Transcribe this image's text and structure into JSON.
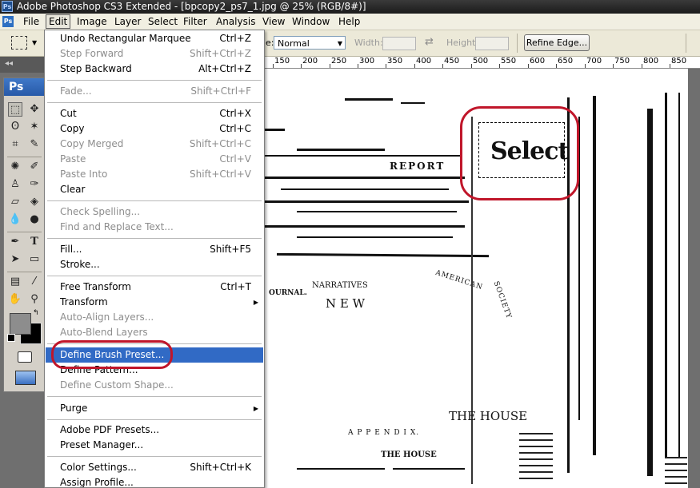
{
  "window": {
    "title": "Adobe Photoshop CS3 Extended - [bpcopy2_ps7_1.jpg @ 25% (RGB/8#)]",
    "app_icon": "Ps"
  },
  "menubar": {
    "items": [
      "File",
      "Edit",
      "Image",
      "Layer",
      "Select",
      "Filter",
      "Analysis",
      "View",
      "Window",
      "Help"
    ],
    "active": "Edit"
  },
  "options": {
    "style_label": "e:",
    "style_value": "Normal",
    "width_label": "Width:",
    "height_label": "Height:",
    "refine_edge": "Refine Edge..."
  },
  "toolbox": {
    "title": "Ps",
    "collapse_glyph": "◂◂"
  },
  "ruler": {
    "labels": [
      "150",
      "200",
      "250",
      "300",
      "350",
      "400",
      "450",
      "500",
      "550",
      "600",
      "650",
      "700",
      "750",
      "800",
      "850"
    ]
  },
  "edit_menu": [
    {
      "label": "Undo Rectangular Marquee",
      "shortcut": "Ctrl+Z",
      "disabled": false
    },
    {
      "label": "Step Forward",
      "shortcut": "Shift+Ctrl+Z",
      "disabled": true
    },
    {
      "label": "Step Backward",
      "shortcut": "Alt+Ctrl+Z",
      "disabled": false
    },
    {
      "label": "Fade...",
      "shortcut": "Shift+Ctrl+F",
      "disabled": true
    },
    {
      "label": "Cut",
      "shortcut": "Ctrl+X",
      "disabled": false
    },
    {
      "label": "Copy",
      "shortcut": "Ctrl+C",
      "disabled": false
    },
    {
      "label": "Copy Merged",
      "shortcut": "Shift+Ctrl+C",
      "disabled": true
    },
    {
      "label": "Paste",
      "shortcut": "Ctrl+V",
      "disabled": true
    },
    {
      "label": "Paste Into",
      "shortcut": "Shift+Ctrl+V",
      "disabled": true
    },
    {
      "label": "Clear",
      "shortcut": "",
      "disabled": false
    },
    {
      "label": "Check Spelling...",
      "shortcut": "",
      "disabled": true
    },
    {
      "label": "Find and Replace Text...",
      "shortcut": "",
      "disabled": true
    },
    {
      "label": "Fill...",
      "shortcut": "Shift+F5",
      "disabled": false
    },
    {
      "label": "Stroke...",
      "shortcut": "",
      "disabled": false
    },
    {
      "label": "Free Transform",
      "shortcut": "Ctrl+T",
      "disabled": false
    },
    {
      "label": "Transform",
      "shortcut": "",
      "disabled": false,
      "submenu": true
    },
    {
      "label": "Auto-Align Layers...",
      "shortcut": "",
      "disabled": true
    },
    {
      "label": "Auto-Blend Layers",
      "shortcut": "",
      "disabled": true
    },
    {
      "label": "Define Brush Preset...",
      "shortcut": "",
      "disabled": false,
      "highlighted": true
    },
    {
      "label": "Define Pattern...",
      "shortcut": "",
      "disabled": false
    },
    {
      "label": "Define Custom Shape...",
      "shortcut": "",
      "disabled": true
    },
    {
      "label": "Purge",
      "shortcut": "",
      "disabled": false,
      "submenu": true
    },
    {
      "label": "Adobe PDF Presets...",
      "shortcut": "",
      "disabled": false
    },
    {
      "label": "Preset Manager...",
      "shortcut": "",
      "disabled": false
    },
    {
      "label": "Color Settings...",
      "shortcut": "Shift+Ctrl+K",
      "disabled": false
    },
    {
      "label": "Assign Profile...",
      "shortcut": "",
      "disabled": false
    }
  ],
  "document": {
    "select_word": "Select",
    "report": "REPORT",
    "narratives": "NARRATIVES",
    "new": "N E W",
    "journal": "OURNAL.",
    "american": "AMERICAN",
    "society": "SOCIETY",
    "the_house_large": "THE HOUSE",
    "appendix": "A P P E N D I X.",
    "the_house_small": "THE HOUSE"
  },
  "colors": {
    "highlight": "#316ac5",
    "annotation": "#c0162a",
    "title_bar": "#1b1b1b",
    "toolbox_header": "#2759a8"
  }
}
